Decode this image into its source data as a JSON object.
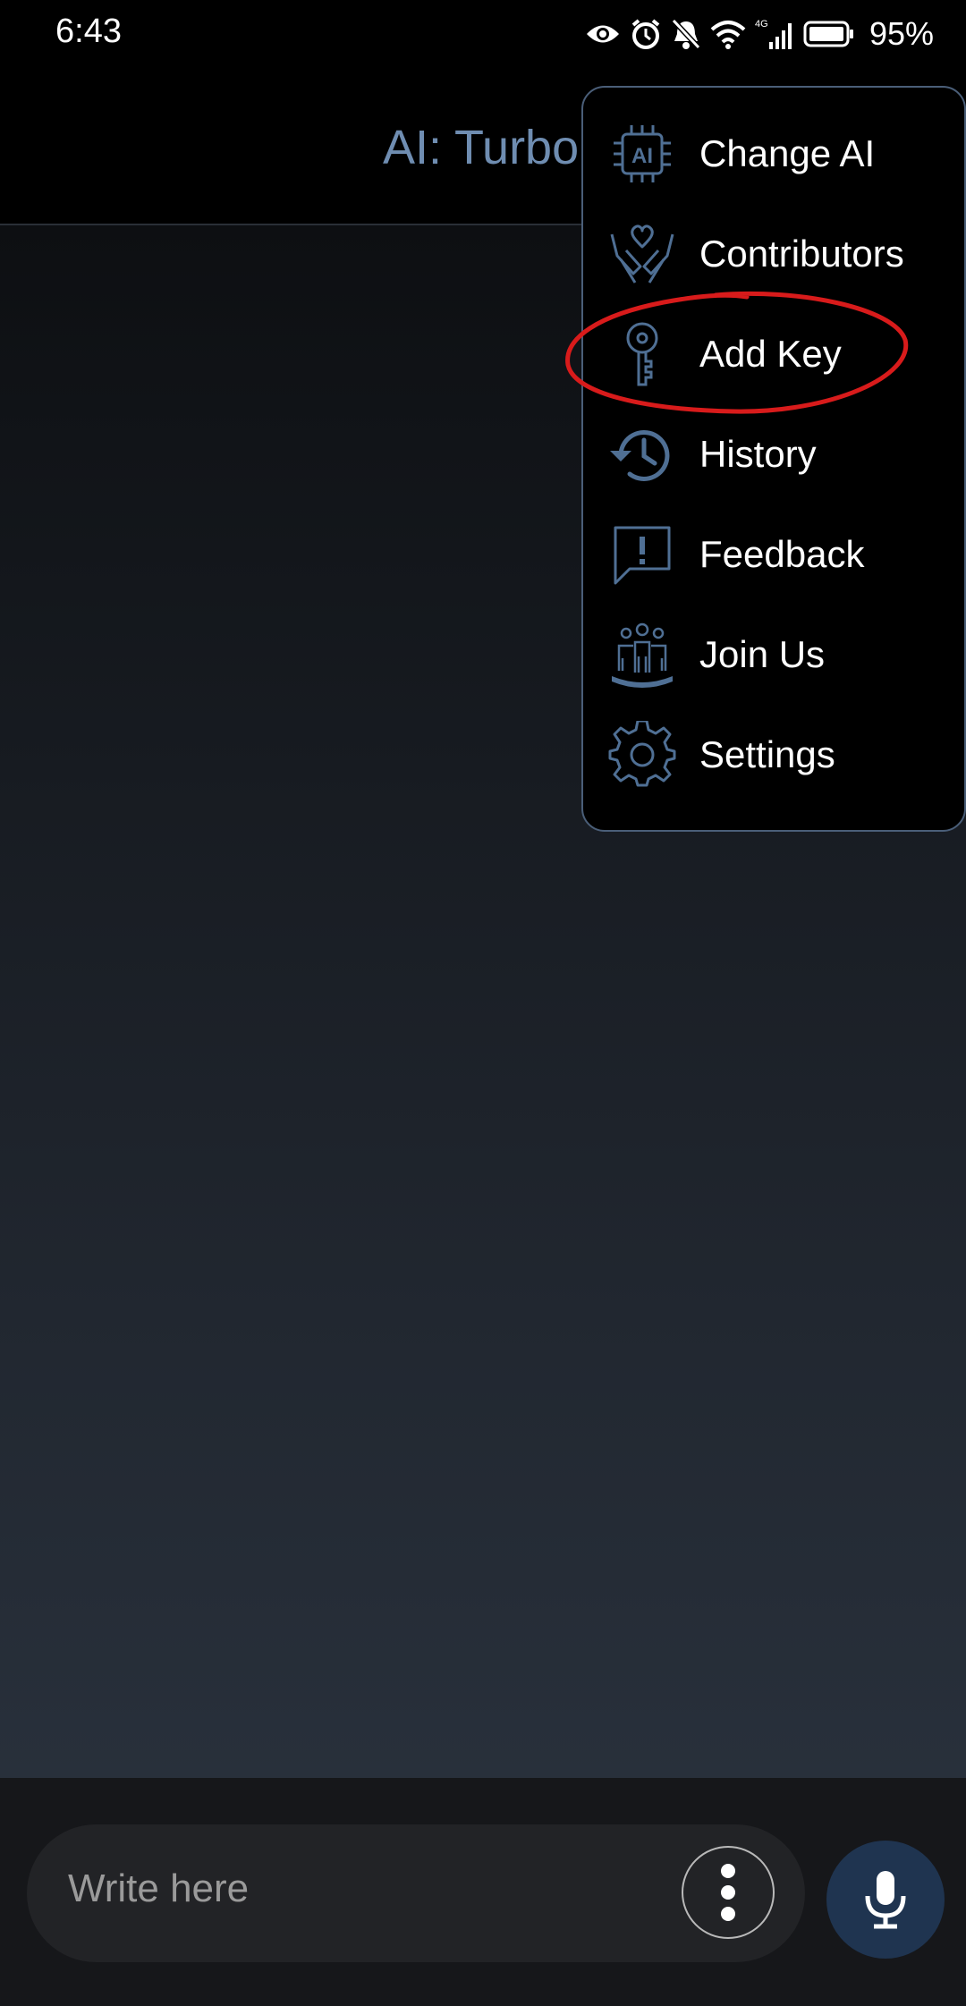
{
  "status_bar": {
    "time": "6:43",
    "battery_percent": "95%",
    "network_label": "4G",
    "icons": [
      "eye-icon",
      "alarm-icon",
      "bell-muted-icon",
      "wifi-icon",
      "cellular-signal-icon",
      "battery-icon"
    ]
  },
  "app_bar": {
    "title": "AI: Turbo"
  },
  "menu": {
    "items": [
      {
        "label": "Change AI",
        "icon": "ai-chip-icon"
      },
      {
        "label": "Contributors",
        "icon": "heart-hands-icon"
      },
      {
        "label": "Add Key",
        "icon": "key-icon"
      },
      {
        "label": "History",
        "icon": "history-icon"
      },
      {
        "label": "Feedback",
        "icon": "feedback-icon"
      },
      {
        "label": "Join Us",
        "icon": "group-icon"
      },
      {
        "label": "Settings",
        "icon": "gear-icon"
      }
    ],
    "highlighted_item": "Add Key"
  },
  "input": {
    "placeholder": "Write here",
    "value": ""
  },
  "colors": {
    "accent": "#6f8db1",
    "icon": "#4f6f94",
    "menu_border": "#4a5e78",
    "mic_button": "#1f3450",
    "annotation": "#d81b1b"
  }
}
